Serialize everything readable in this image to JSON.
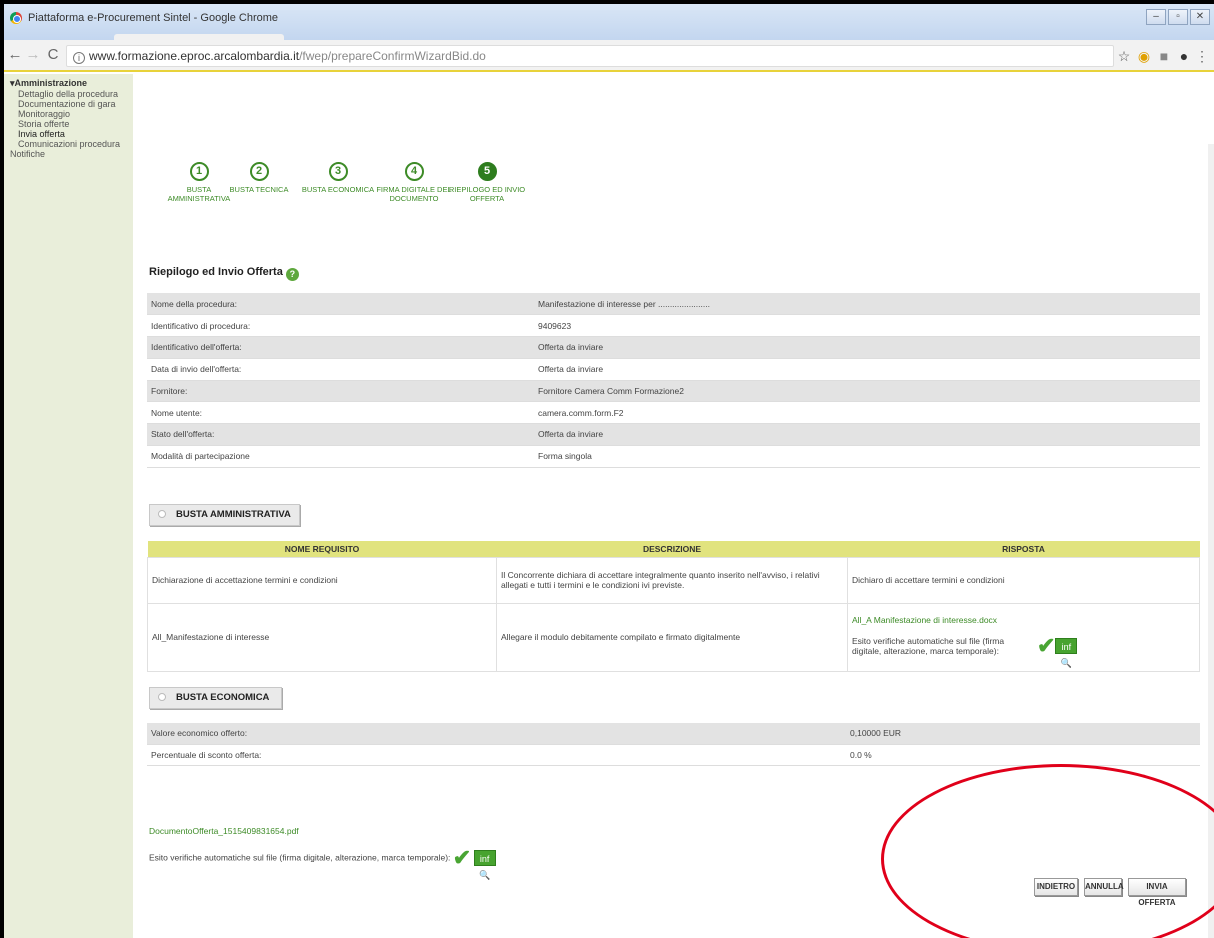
{
  "window": {
    "title": "Piattaforma e-Procurement Sintel - Google Chrome",
    "controls": [
      "–",
      "▫",
      "✕"
    ]
  },
  "toolbar": {
    "url_host": "www.formazione.eproc.arcalombardia.it",
    "url_path": "/fwep/prepareConfirmWizardBid.do",
    "nav_back": "←",
    "nav_forward": "→",
    "nav_reload": "C",
    "info": "i",
    "star": "☆"
  },
  "sidebar": {
    "section": "▾Amministrazione",
    "items": [
      "Dettaglio della procedura",
      "Documentazione di gara",
      "Monitoraggio",
      "Storia offerte",
      "Invia offerta",
      "Comunicazioni procedura"
    ],
    "notifiche": "Notifiche"
  },
  "steps": [
    {
      "num": "1",
      "label": "BUSTA AMMINISTRATIVA"
    },
    {
      "num": "2",
      "label": "BUSTA TECNICA"
    },
    {
      "num": "3",
      "label": "BUSTA ECONOMICA"
    },
    {
      "num": "4",
      "label": "FIRMA DIGITALE DEL DOCUMENTO"
    },
    {
      "num": "5",
      "label": "RIEPILOGO ED INVIO OFFERTA"
    }
  ],
  "summary": {
    "title": "Riepilogo ed Invio Offerta",
    "help": "?",
    "rows": [
      {
        "label": "Nome della procedura:",
        "value": "Manifestazione di interesse per ......................"
      },
      {
        "label": "Identificativo di procedura:",
        "value": "9409623"
      },
      {
        "label": "Identificativo dell'offerta:",
        "value": "Offerta da inviare"
      },
      {
        "label": "Data di invio dell'offerta:",
        "value": "Offerta da inviare"
      },
      {
        "label": "Fornitore:",
        "value": "Fornitore Camera Comm Formazione2"
      },
      {
        "label": "Nome utente:",
        "value": "camera.comm.form.F2"
      },
      {
        "label": "Stato dell'offerta:",
        "value": "Offerta da inviare"
      },
      {
        "label": "Modalità di partecipazione",
        "value": "Forma singola"
      }
    ]
  },
  "busta_amministrativa": {
    "tab_label": "BUSTA AMMINISTRATIVA",
    "headers": [
      "NOME REQUISITO",
      "DESCRIZIONE",
      "RISPOSTA"
    ],
    "rows": [
      {
        "nome": "Dichiarazione di accettazione termini e condizioni",
        "descrizione": "Il Concorrente dichiara di accettare integralmente quanto inserito nell'avviso, i relativi allegati e tutti i termini e le condizioni ivi previste.",
        "risposta": "Dichiaro di accettare termini e condizioni"
      },
      {
        "nome": "All_Manifestazione di interesse",
        "descrizione": "Allegare il modulo debitamente compilato e firmato digitalmente",
        "file": "All_A Manifestazione di interesse.docx",
        "esito": "Esito verifiche automatiche sul file (firma digitale, alterazione, marca temporale):",
        "check": "✔",
        "inf": "inf🔍"
      }
    ]
  },
  "busta_economica": {
    "tab_label": "BUSTA ECONOMICA",
    "rows": [
      {
        "label": "Valore economico offerto:",
        "value": "0,10000  EUR"
      },
      {
        "label": "Percentuale di sconto offerta:",
        "value": "0.0  %"
      }
    ]
  },
  "documento": {
    "link": "DocumentoOfferta_1515409831654.pdf",
    "esito": "Esito verifiche automatiche sul file (firma digitale, alterazione, marca temporale):",
    "check": "✔",
    "inf": "inf🔍"
  },
  "buttons": {
    "indietro": "INDIETRO",
    "annulla": "ANNULLA",
    "invia": "INVIA OFFERTA"
  },
  "colors": {
    "accent_green": "#3d8b27",
    "table_header_yellow": "#e1e37e",
    "annotation_red": "#e0001a"
  }
}
